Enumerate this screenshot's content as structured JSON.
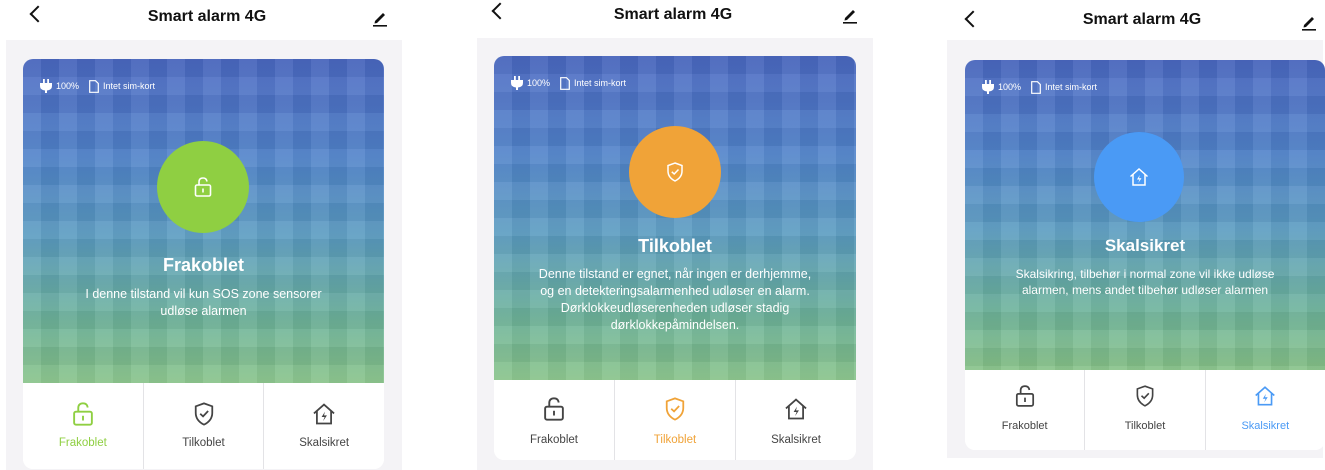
{
  "colors": {
    "green": "#8fcf42",
    "orange": "#f0a338",
    "blue": "#4a9af5"
  },
  "panels": [
    {
      "header": {
        "title": "Smart alarm 4G"
      },
      "status": {
        "battery": "100%",
        "sim": "Intet sim-kort"
      },
      "mode": {
        "icon": "unlock-icon",
        "color": "#8fcf42",
        "title": "Frakoblet",
        "description": "I denne tilstand vil kun SOS zone sensorer udløse alarmen"
      },
      "tabs": [
        {
          "label": "Frakoblet",
          "icon": "unlock-icon",
          "active": true
        },
        {
          "label": "Tilkoblet",
          "icon": "shield-check-icon",
          "active": false
        },
        {
          "label": "Skalsikret",
          "icon": "home-bolt-icon",
          "active": false
        }
      ]
    },
    {
      "header": {
        "title": "Smart alarm 4G"
      },
      "status": {
        "battery": "100%",
        "sim": "Intet sim-kort"
      },
      "mode": {
        "icon": "shield-check-icon",
        "color": "#f0a338",
        "title": "Tilkoblet",
        "description": "Denne tilstand er egnet, når ingen er derhjemme, og en detekteringsalarmenhed udløser en alarm. Dørklokkeudløserenheden udløser stadig dørklokkepåmindelsen."
      },
      "tabs": [
        {
          "label": "Frakoblet",
          "icon": "unlock-icon",
          "active": false
        },
        {
          "label": "Tilkoblet",
          "icon": "shield-check-icon",
          "active": true
        },
        {
          "label": "Skalsikret",
          "icon": "home-bolt-icon",
          "active": false
        }
      ]
    },
    {
      "header": {
        "title": "Smart alarm 4G"
      },
      "status": {
        "battery": "100%",
        "sim": "Intet sim-kort"
      },
      "mode": {
        "icon": "home-bolt-icon",
        "color": "#4a9af5",
        "title": "Skalsikret",
        "description": "Skalsikring, tilbehør i normal zone vil ikke udløse alarmen, mens andet tilbehør udløser alarmen"
      },
      "tabs": [
        {
          "label": "Frakoblet",
          "icon": "unlock-icon",
          "active": false
        },
        {
          "label": "Tilkoblet",
          "icon": "shield-check-icon",
          "active": false
        },
        {
          "label": "Skalsikret",
          "icon": "home-bolt-icon",
          "active": true
        }
      ]
    }
  ]
}
